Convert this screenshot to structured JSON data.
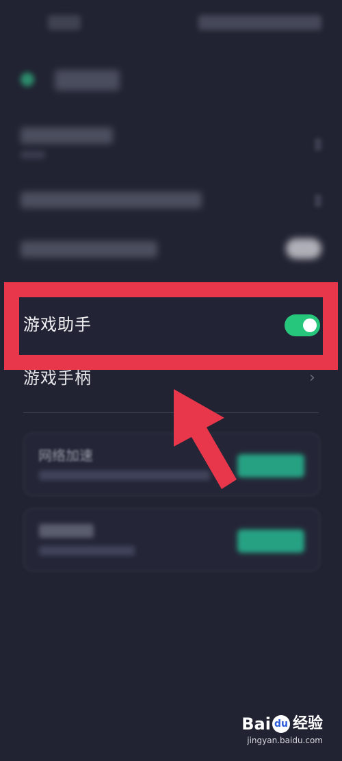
{
  "settings": {
    "game_assistant_label": "游戏助手",
    "game_assistant_enabled": true,
    "gamepad_label": "游戏手柄",
    "chevron_glyph": "›"
  },
  "cards": {
    "network_boost_title": "网络加速"
  },
  "annotation": {
    "highlight_color": "#e8364a",
    "arrow_color": "#e8364a"
  },
  "watermark": {
    "brand_prefix": "Bai",
    "brand_paw": "du",
    "brand_suffix": "经验",
    "url": "jingyan.baidu.com"
  },
  "colors": {
    "background": "#212332",
    "toggle_on": "#26c77c",
    "card_button": "#27b08c"
  }
}
